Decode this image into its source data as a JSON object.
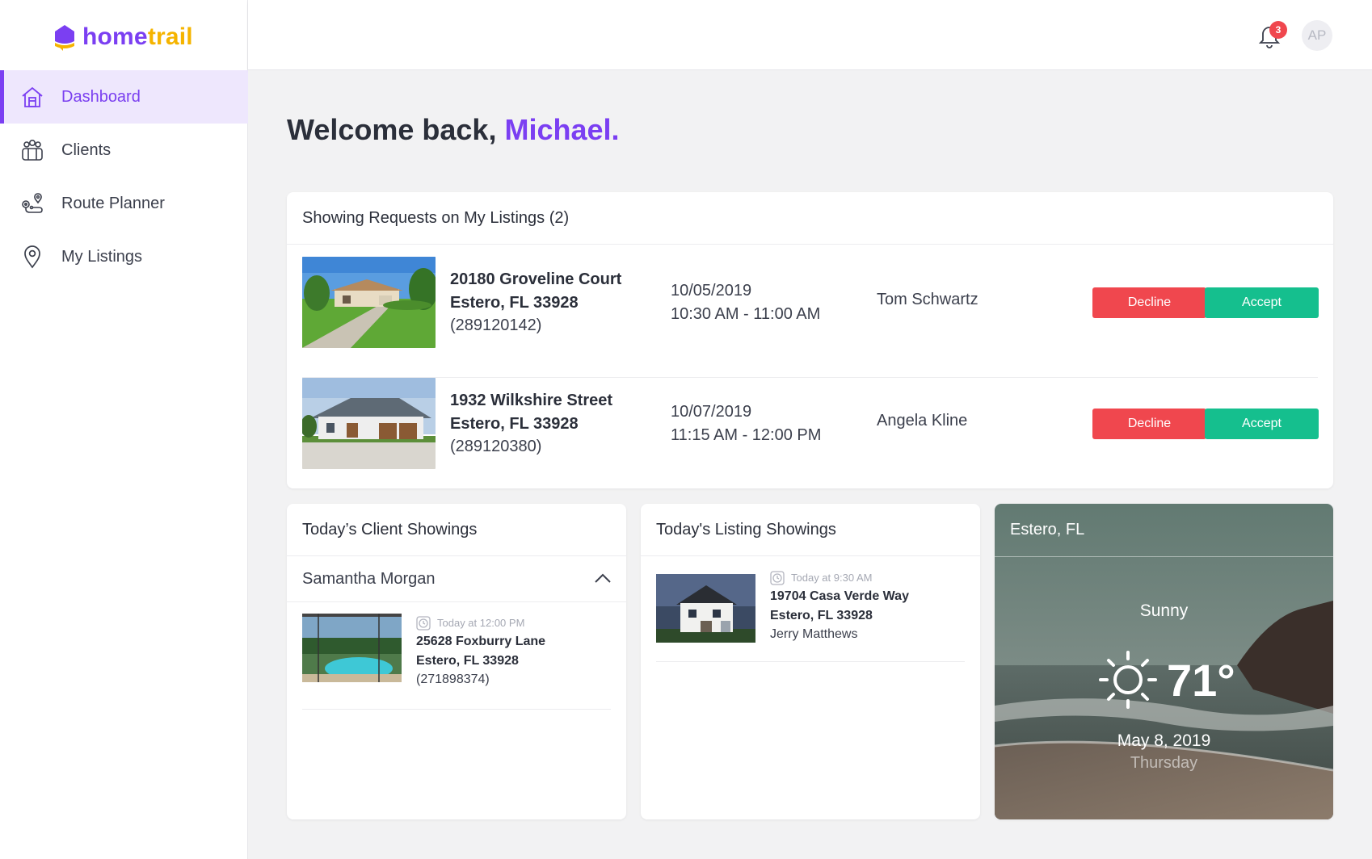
{
  "brand": {
    "part1": "home",
    "part2": "trail"
  },
  "sidebar": {
    "items": [
      {
        "label": "Dashboard",
        "icon": "home-icon",
        "active": true
      },
      {
        "label": "Clients",
        "icon": "clients-icon"
      },
      {
        "label": "Route Planner",
        "icon": "route-icon"
      },
      {
        "label": "My Listings",
        "icon": "pin-icon"
      }
    ]
  },
  "topbar": {
    "notification_count": "3",
    "avatar_initials": "AP"
  },
  "welcome": {
    "prefix": "Welcome back,",
    "name": "Michael."
  },
  "showing_requests": {
    "title": "Showing Requests on My Listings (2)",
    "rows": [
      {
        "street": "20180 Groveline Court",
        "city": "Estero, FL 33928",
        "mls": "(289120142)",
        "date": "10/05/2019",
        "time": "10:30 AM - 11:00 AM",
        "client": "Tom Schwartz",
        "decline": "Decline",
        "accept": "Accept"
      },
      {
        "street": "1932 Wilkshire Street",
        "city": "Estero, FL 33928",
        "mls": "(289120380)",
        "date": "10/07/2019",
        "time": "11:15 AM - 12:00 PM",
        "client": "Angela Kline",
        "decline": "Decline",
        "accept": "Accept"
      }
    ]
  },
  "client_showings": {
    "title": "Today’s Client Showings",
    "client": "Samantha Morgan",
    "items": [
      {
        "time": "Today at 12:00 PM",
        "street": "25628 Foxburry Lane",
        "city": "Estero, FL 33928",
        "mls": "(271898374)"
      }
    ]
  },
  "listing_showings": {
    "title": "Today's Listing Showings",
    "items": [
      {
        "time": "Today at 9:30 AM",
        "street": "19704 Casa Verde Way",
        "city": "Estero, FL 33928",
        "agent": "Jerry Matthews"
      }
    ]
  },
  "weather": {
    "location": "Estero, FL",
    "condition": "Sunny",
    "temp": "71°",
    "date": "May 8, 2019",
    "day": "Thursday",
    "icon": "sun-icon"
  },
  "colors": {
    "accent": "#7b3ff2",
    "brand_yellow": "#f5b400",
    "decline": "#f0474e",
    "accept": "#15bf8e"
  }
}
